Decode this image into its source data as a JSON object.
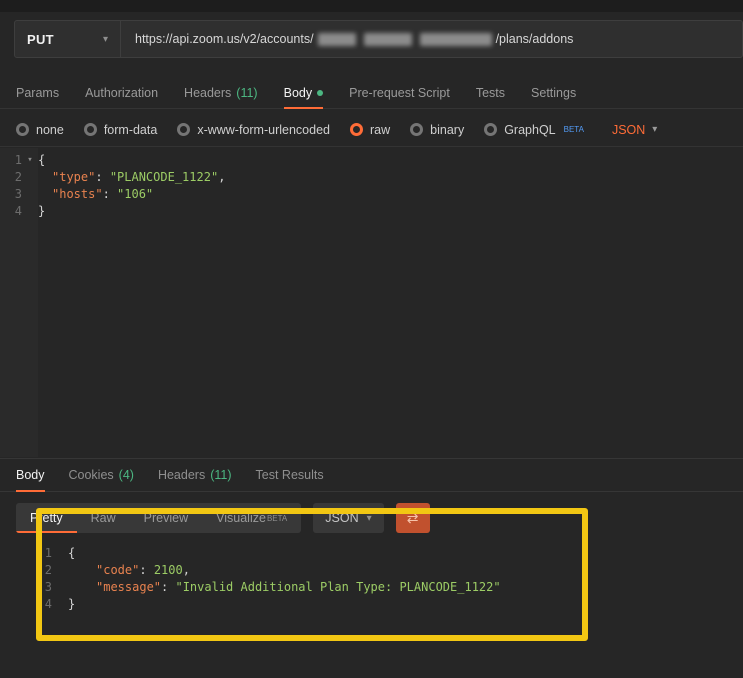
{
  "colors": {
    "accent": "#ff6c37",
    "annotation_yellow": "#f2c713",
    "count_green": "#4cb782",
    "key_orange": "#e8824f",
    "value_green": "#9ccc65",
    "beta_blue": "#539bf5"
  },
  "request": {
    "method": "PUT",
    "url_prefix": "https://api.zoom.us/v2/accounts/",
    "url_suffix": "/plans/addons"
  },
  "request_tabs": [
    {
      "label": "Params"
    },
    {
      "label": "Authorization"
    },
    {
      "label": "Headers",
      "count": "(11)"
    },
    {
      "label": "Body",
      "active": true,
      "dot": true
    },
    {
      "label": "Pre-request Script"
    },
    {
      "label": "Tests"
    },
    {
      "label": "Settings"
    }
  ],
  "body_modes": {
    "options": [
      {
        "label": "none"
      },
      {
        "label": "form-data"
      },
      {
        "label": "x-www-form-urlencoded"
      },
      {
        "label": "raw",
        "selected": true
      },
      {
        "label": "binary"
      },
      {
        "label": "GraphQL",
        "beta": "BETA"
      }
    ],
    "format": "JSON"
  },
  "request_editor": {
    "lines": [
      {
        "num": "1",
        "fold": true,
        "indent": 0,
        "tokens": [
          {
            "t": "p",
            "s": "{"
          }
        ]
      },
      {
        "num": "2",
        "indent": 1,
        "tokens": [
          {
            "t": "k",
            "s": "\"type\""
          },
          {
            "t": "p",
            "s": ": "
          },
          {
            "t": "s",
            "s": "\"PLANCODE_1122\""
          },
          {
            "t": "p",
            "s": ","
          }
        ]
      },
      {
        "num": "3",
        "indent": 1,
        "tokens": [
          {
            "t": "k",
            "s": "\"hosts\""
          },
          {
            "t": "p",
            "s": ": "
          },
          {
            "t": "s",
            "s": "\"106\""
          }
        ]
      },
      {
        "num": "4",
        "indent": 0,
        "tokens": [
          {
            "t": "p",
            "s": "}"
          }
        ]
      }
    ]
  },
  "response_tabs": [
    {
      "label": "Body",
      "active": true
    },
    {
      "label": "Cookies",
      "count": "(4)"
    },
    {
      "label": "Headers",
      "count": "(11)"
    },
    {
      "label": "Test Results"
    }
  ],
  "response_toolbar": {
    "views": [
      {
        "label": "Pretty",
        "active": true
      },
      {
        "label": "Raw"
      },
      {
        "label": "Preview"
      },
      {
        "label": "Visualize",
        "beta": "BETA"
      }
    ],
    "format": "JSON"
  },
  "response_editor": {
    "lines": [
      {
        "num": "1",
        "indent": 0,
        "tokens": [
          {
            "t": "p",
            "s": "{"
          }
        ]
      },
      {
        "num": "2",
        "indent": 2,
        "tokens": [
          {
            "t": "k",
            "s": "\"code\""
          },
          {
            "t": "p",
            "s": ": "
          },
          {
            "t": "n",
            "s": "2100"
          },
          {
            "t": "p",
            "s": ","
          }
        ]
      },
      {
        "num": "3",
        "indent": 2,
        "tokens": [
          {
            "t": "k",
            "s": "\"message\""
          },
          {
            "t": "p",
            "s": ": "
          },
          {
            "t": "s",
            "s": "\"Invalid Additional Plan Type: PLANCODE_1122\""
          }
        ]
      },
      {
        "num": "4",
        "indent": 0,
        "tokens": [
          {
            "t": "p",
            "s": "}"
          }
        ]
      }
    ]
  }
}
